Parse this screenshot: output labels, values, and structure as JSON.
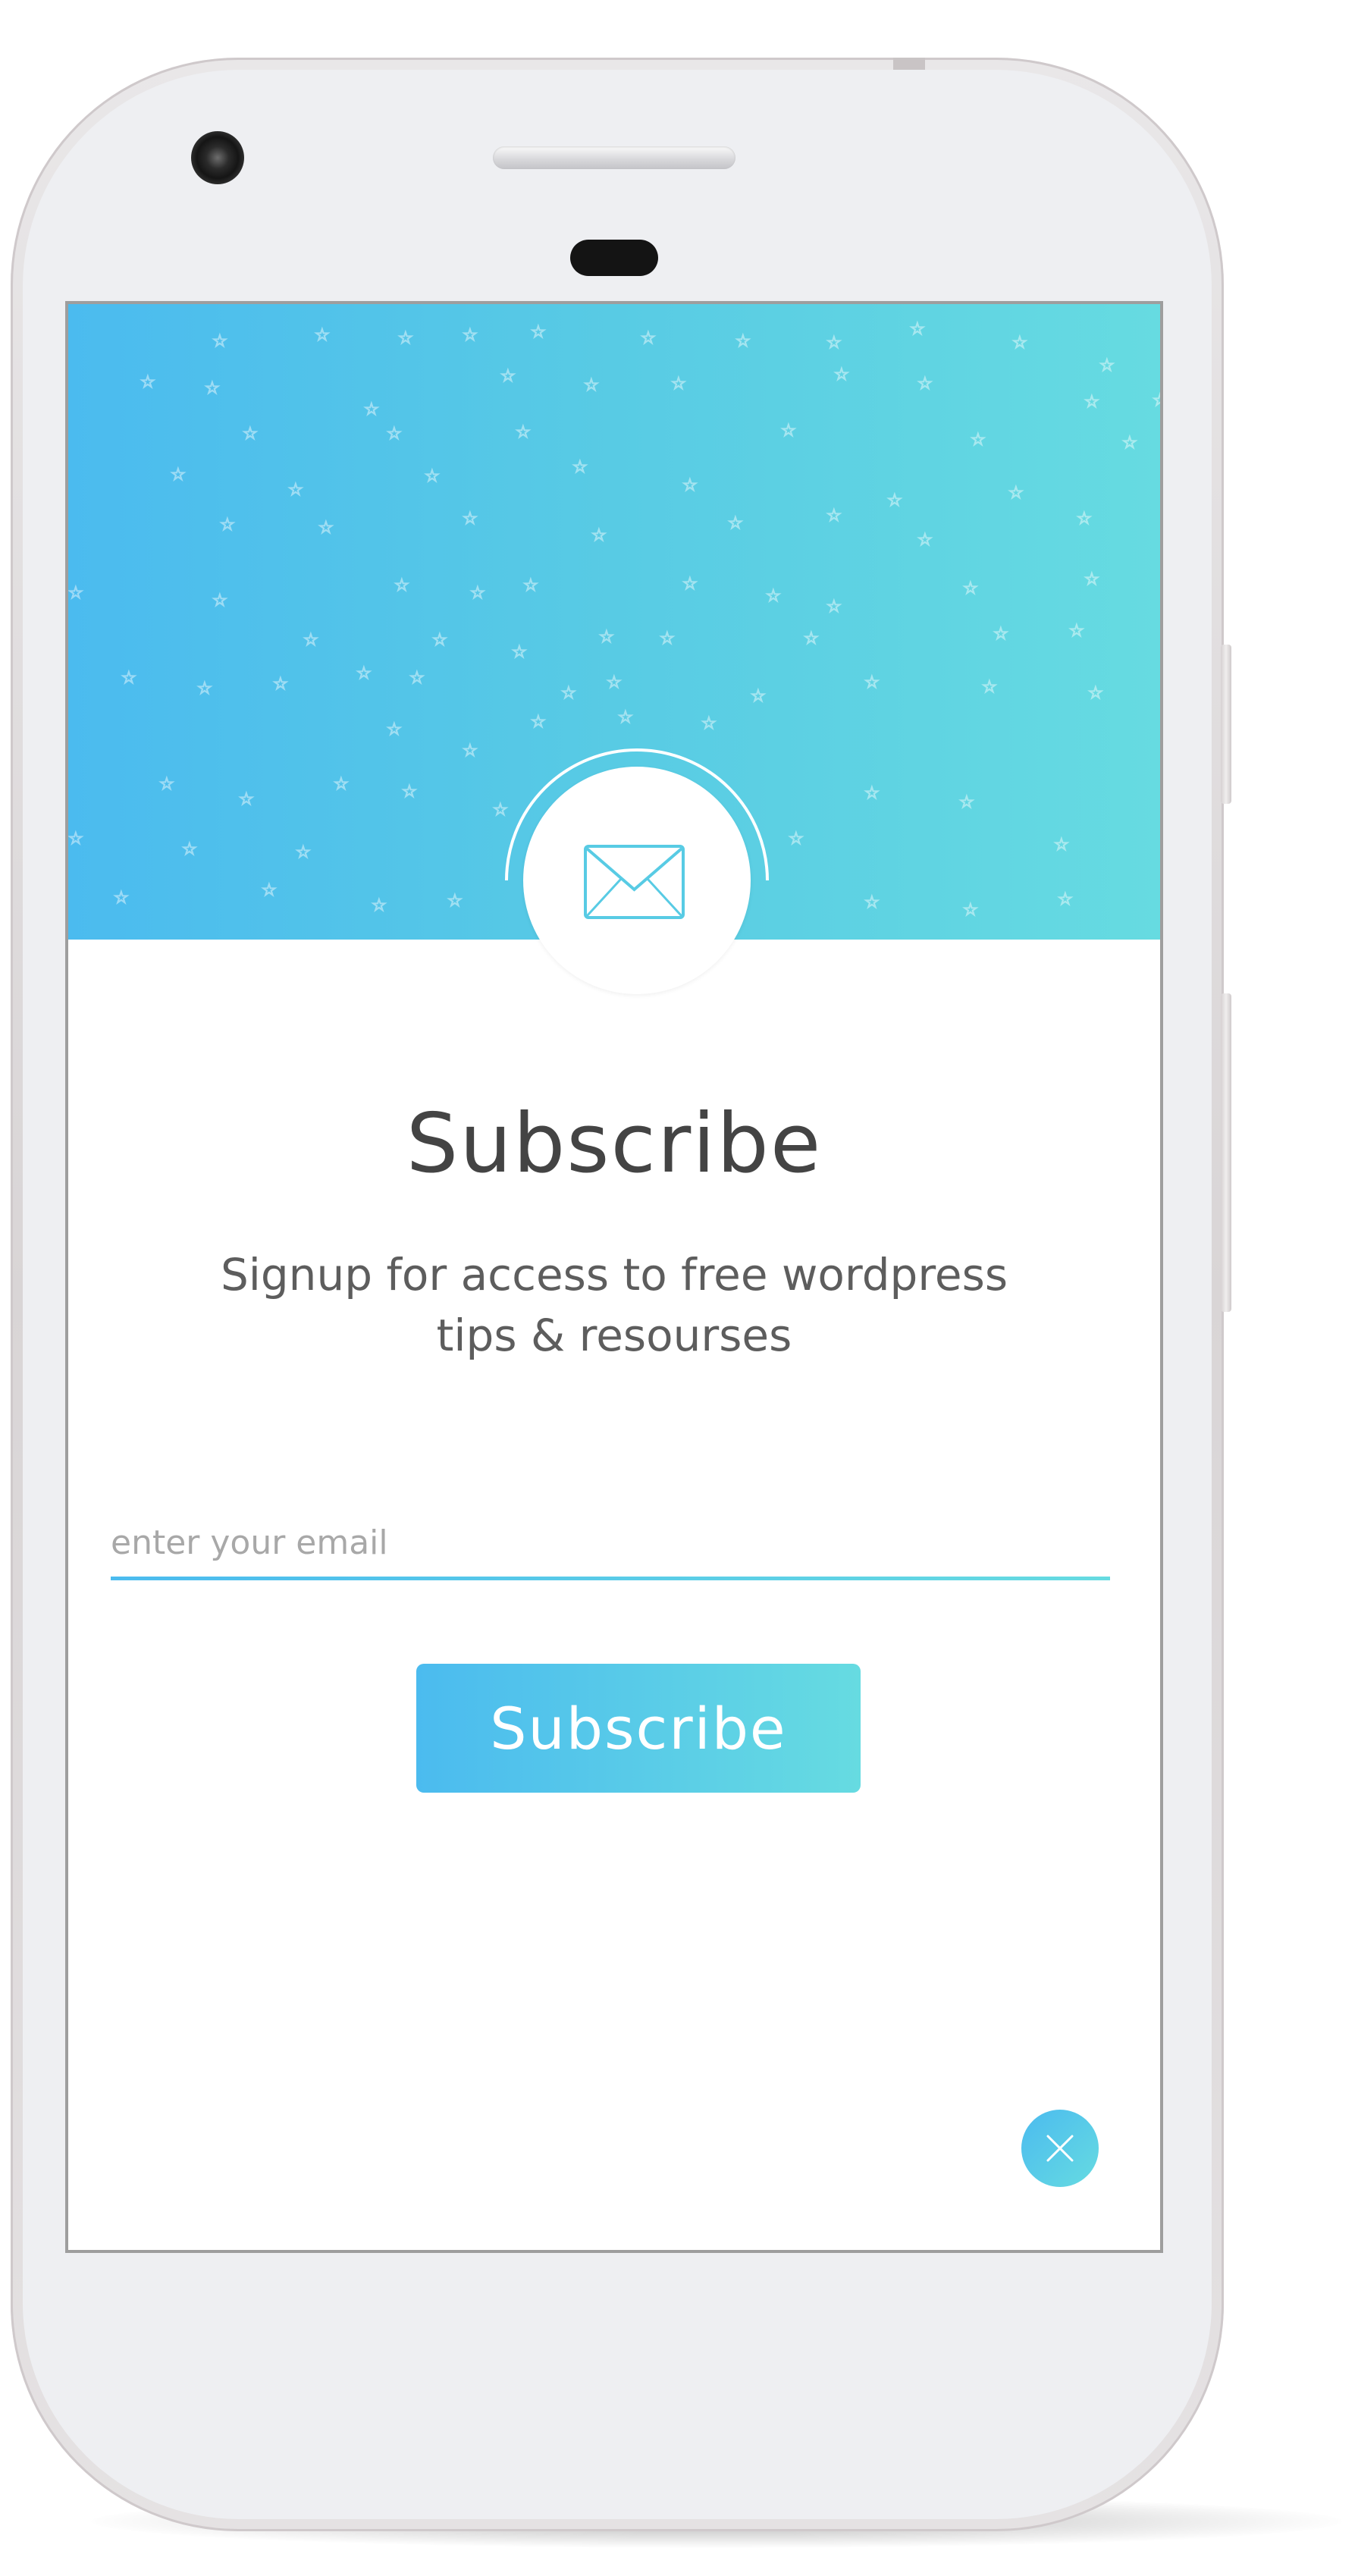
{
  "popup": {
    "title": "Subscribe",
    "subtitle": "Signup for access to free wordpress tips & resourses",
    "email_placeholder": "enter your email",
    "email_value": "",
    "button_label": "Subscribe"
  },
  "icons": {
    "header_icon": "envelope-icon",
    "close_icon": "close-icon"
  },
  "colors": {
    "gradient_start": "#4bbbef",
    "gradient_end": "#66dbe1",
    "title_text": "#444444",
    "subtitle_text": "#5d5d5d",
    "placeholder_text": "#a8a8a8"
  }
}
